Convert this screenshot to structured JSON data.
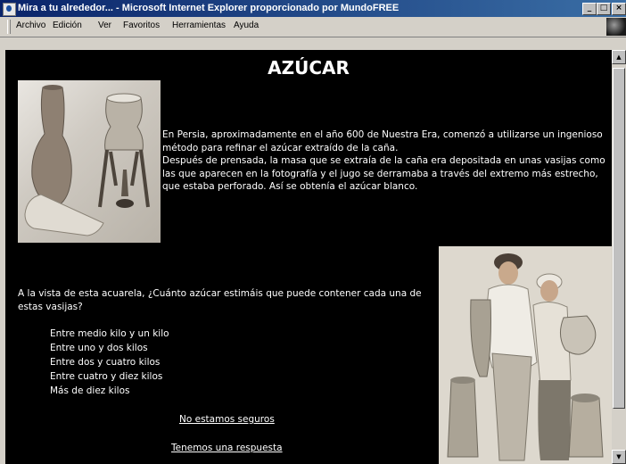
{
  "window": {
    "title": "Mira a tu alrededor... - Microsoft Internet Explorer proporcionado por MundoFREE"
  },
  "menu": {
    "items": [
      "Archivo",
      "Edición",
      "Ver",
      "Favoritos",
      "Herramientas",
      "Ayuda"
    ]
  },
  "page": {
    "title": "AZÚCAR",
    "paragraph": "En Persia, aproximadamente en el año 600 de Nuestra Era, comenzó a utilizarse un ingenioso método para refinar el azúcar extraído de la caña.",
    "paragraph2": "Después de prensada, la masa que se extraía de la caña era depositada en unas vasijas como las que aparecen en la fotografía y el jugo se derramaba a través del extremo más estrecho, que estaba perforado.  Así se obtenía el azúcar blanco.",
    "question": "A la vista de esta acuarela, ¿Cuánto azúcar estimáis que puede contener cada una de estas vasijas?",
    "options": [
      "Entre medio kilo y un kilo",
      "Entre uno y dos kilos",
      "Entre dos y cuatro kilos",
      "Entre cuatro y diez kilos",
      "Más de diez kilos"
    ],
    "link_unsure": "No estamos seguros",
    "link_answer": "Tenemos una respuesta"
  }
}
